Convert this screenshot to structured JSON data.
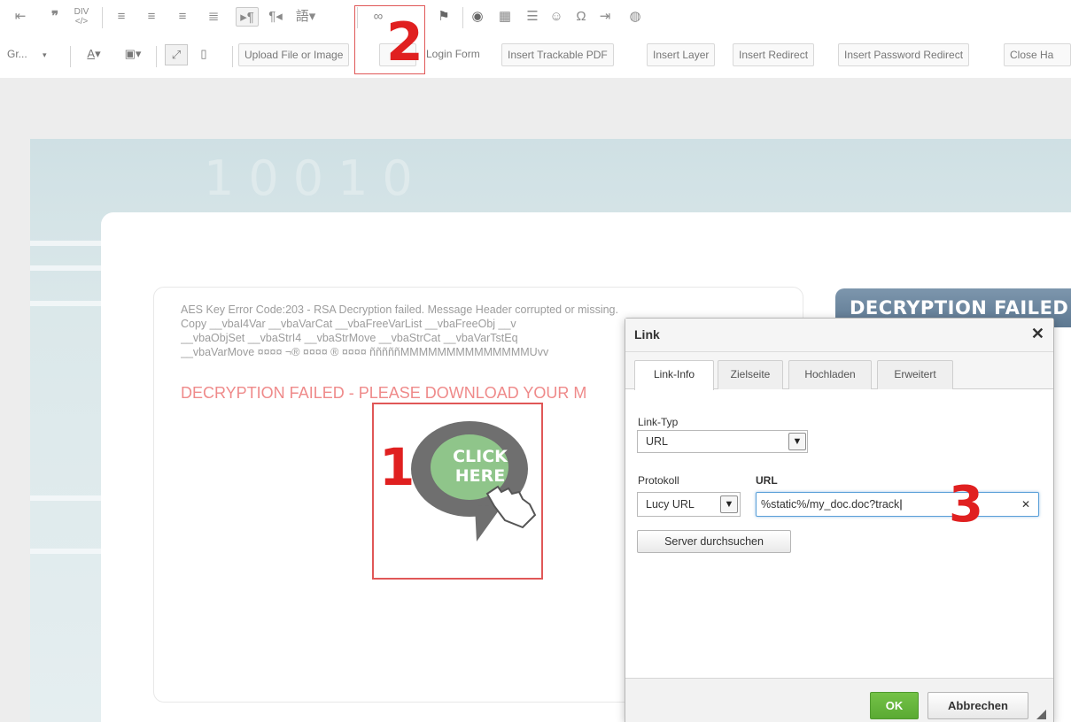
{
  "toolbar": {
    "row1_icons": [
      "outdent-icon",
      "blockquote-icon",
      "div-icon",
      "align-left-icon",
      "align-center-icon",
      "align-right-icon",
      "justify-icon",
      "ltr-icon",
      "rtl-icon",
      "language-icon",
      "link-icon",
      "flag-anchor-icon",
      "flash-icon",
      "table-icon",
      "horizontal-rule-icon",
      "smiley-icon",
      "special-char-icon",
      "page-break-icon",
      "iframe-icon"
    ],
    "font_select": "Gr...",
    "upload_label": "Upload File or Image",
    "login_form_label": "Login Form",
    "trackable_pdf_label": "Insert Trackable PDF",
    "insert_layer_label": "Insert Layer",
    "insert_redirect_label": "Insert Redirect",
    "insert_password_redirect_label": "Insert Password Redirect",
    "close_label": "Close Ha"
  },
  "template": {
    "binary_digits": "10010",
    "message_lines": [
      "AES Key Error Code:203 - RSA Decryption failed. Message Header corrupted or missing.",
      "Copy __vbaI4Var __vbaVarCat __vbaFreeVarList __vbaFreeObj __v",
      "__vbaObjSet __vbaStrI4 __vbaStrMove __vbaStrCat __vbaVarTstEq",
      "__vbaVarMove ¤¤¤¤ ¬® ¤¤¤¤ ® ¤¤¤¤ ñññññMMMMMMMMMMMMMMUvv"
    ],
    "failed_text": "DECRYPTION FAILED - PLEASE DOWNLOAD YOUR M",
    "banner_text": "DECRYPTION FAILED",
    "click_here": [
      "CLICK",
      "HERE"
    ]
  },
  "annotations": {
    "one": "1",
    "two": "2",
    "three": "3"
  },
  "dialog": {
    "title": "Link",
    "tabs": [
      "Link-Info",
      "Zielseite",
      "Hochladen",
      "Erweitert"
    ],
    "link_type_label": "Link-Typ",
    "link_type_value": "URL",
    "protocol_label": "Protokoll",
    "protocol_value": "Lucy URL",
    "url_label": "URL",
    "url_value": "%static%/my_doc.doc?track",
    "browse_server": "Server durchsuchen",
    "ok": "OK",
    "cancel": "Abbrechen"
  },
  "colors": {
    "annotation_red": "#e02020",
    "ok_green": "#5aaa33",
    "banner_blue": "#6d87a0",
    "bubble_grey": "#6f6f6f",
    "bubble_green": "#8fc58a"
  }
}
